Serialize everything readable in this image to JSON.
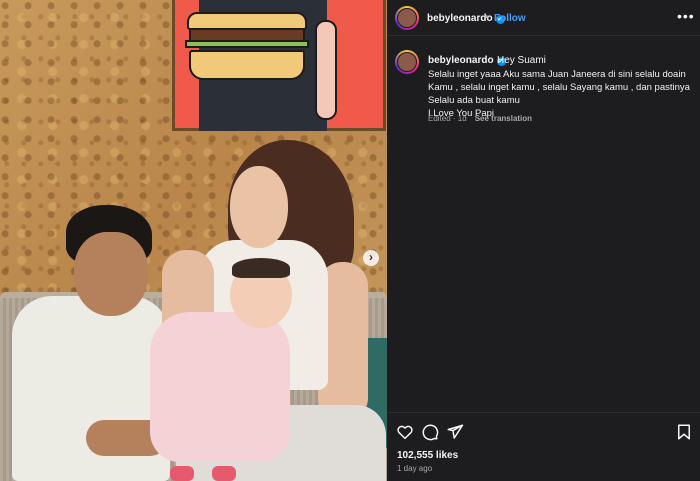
{
  "post": {
    "username": "bebyleonardo",
    "verified_mark": "✓",
    "separator": "•",
    "follow_label": "Follow",
    "more_label": "•••",
    "next_label": "›",
    "caption": {
      "title": "Hey Suami",
      "lines": [
        "Selalu inget yaaa Aku sama Juan Janeera di sini selalu doain Kamu , selalu inget kamu , selalu Sayang kamu , dan pastinya Selalu ada buat kamu",
        "I Love You Papi"
      ],
      "edited": "Edited · 1d",
      "see_translation": "See translation"
    },
    "likes": "102,555 likes",
    "time_ago": "1 day ago"
  },
  "icons": [
    "heart-icon",
    "comment-icon",
    "share-icon",
    "bookmark-icon",
    "verified-icon",
    "more-icon",
    "chevron-right-icon"
  ],
  "colors": {
    "panel_bg": "#1d1d1f",
    "follow_blue": "#4a9df8",
    "verified_blue": "#0095f6",
    "muted_text": "#a8a8a8"
  }
}
